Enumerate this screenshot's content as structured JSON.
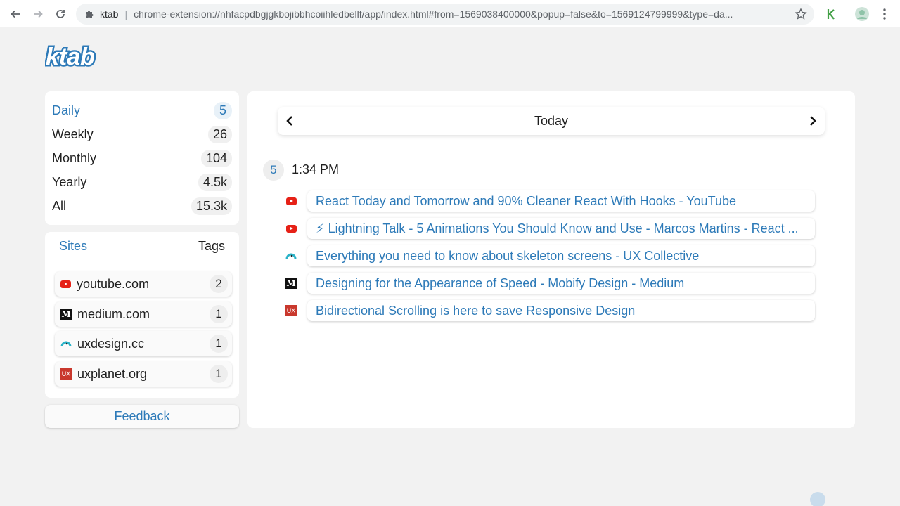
{
  "browser": {
    "tab_label": "ktab",
    "url": "chrome-extension://nhfacpdbgjgkbojibbhcoiihledbellf/app/index.html#from=1569038400000&popup=false&to=1569124799999&type=da..."
  },
  "logo": {
    "text": "ktab"
  },
  "periods": [
    {
      "label": "Daily",
      "count": "5"
    },
    {
      "label": "Weekly",
      "count": "26"
    },
    {
      "label": "Monthly",
      "count": "104"
    },
    {
      "label": "Yearly",
      "count": "4.5k"
    },
    {
      "label": "All",
      "count": "15.3k"
    }
  ],
  "sites_panel": {
    "tab_sites": "Sites",
    "tab_tags": "Tags",
    "sites": [
      {
        "name": "youtube.com",
        "count": "2",
        "icon": "youtube-icon"
      },
      {
        "name": "medium.com",
        "count": "1",
        "icon": "medium-icon"
      },
      {
        "name": "uxdesign.cc",
        "count": "1",
        "icon": "uxdesign-icon"
      },
      {
        "name": "uxplanet.org",
        "count": "1",
        "icon": "uxplanet-icon"
      }
    ]
  },
  "feedback_label": "Feedback",
  "main": {
    "date_title": "Today",
    "group": {
      "count": "5",
      "time": "1:34 PM"
    },
    "entries": [
      {
        "title": "React Today and Tomorrow and 90% Cleaner React With Hooks - YouTube",
        "icon": "youtube-icon"
      },
      {
        "title": "⚡ Lightning Talk - 5 Animations You Should Know and Use - Marcos Martins - React ...",
        "icon": "youtube-icon"
      },
      {
        "title": "Everything you need to know about skeleton screens - UX Collective",
        "icon": "uxdesign-icon"
      },
      {
        "title": "Designing for the Appearance of Speed - Mobify Design - Medium",
        "icon": "medium-icon"
      },
      {
        "title": "Bidirectional Scrolling is here to save Responsive Design",
        "icon": "uxplanet-icon"
      }
    ]
  },
  "colors": {
    "accent": "#2d7ab8",
    "youtube": "#e62117",
    "uxplanet": "#c9382d",
    "ktab_green": "#43a047"
  }
}
